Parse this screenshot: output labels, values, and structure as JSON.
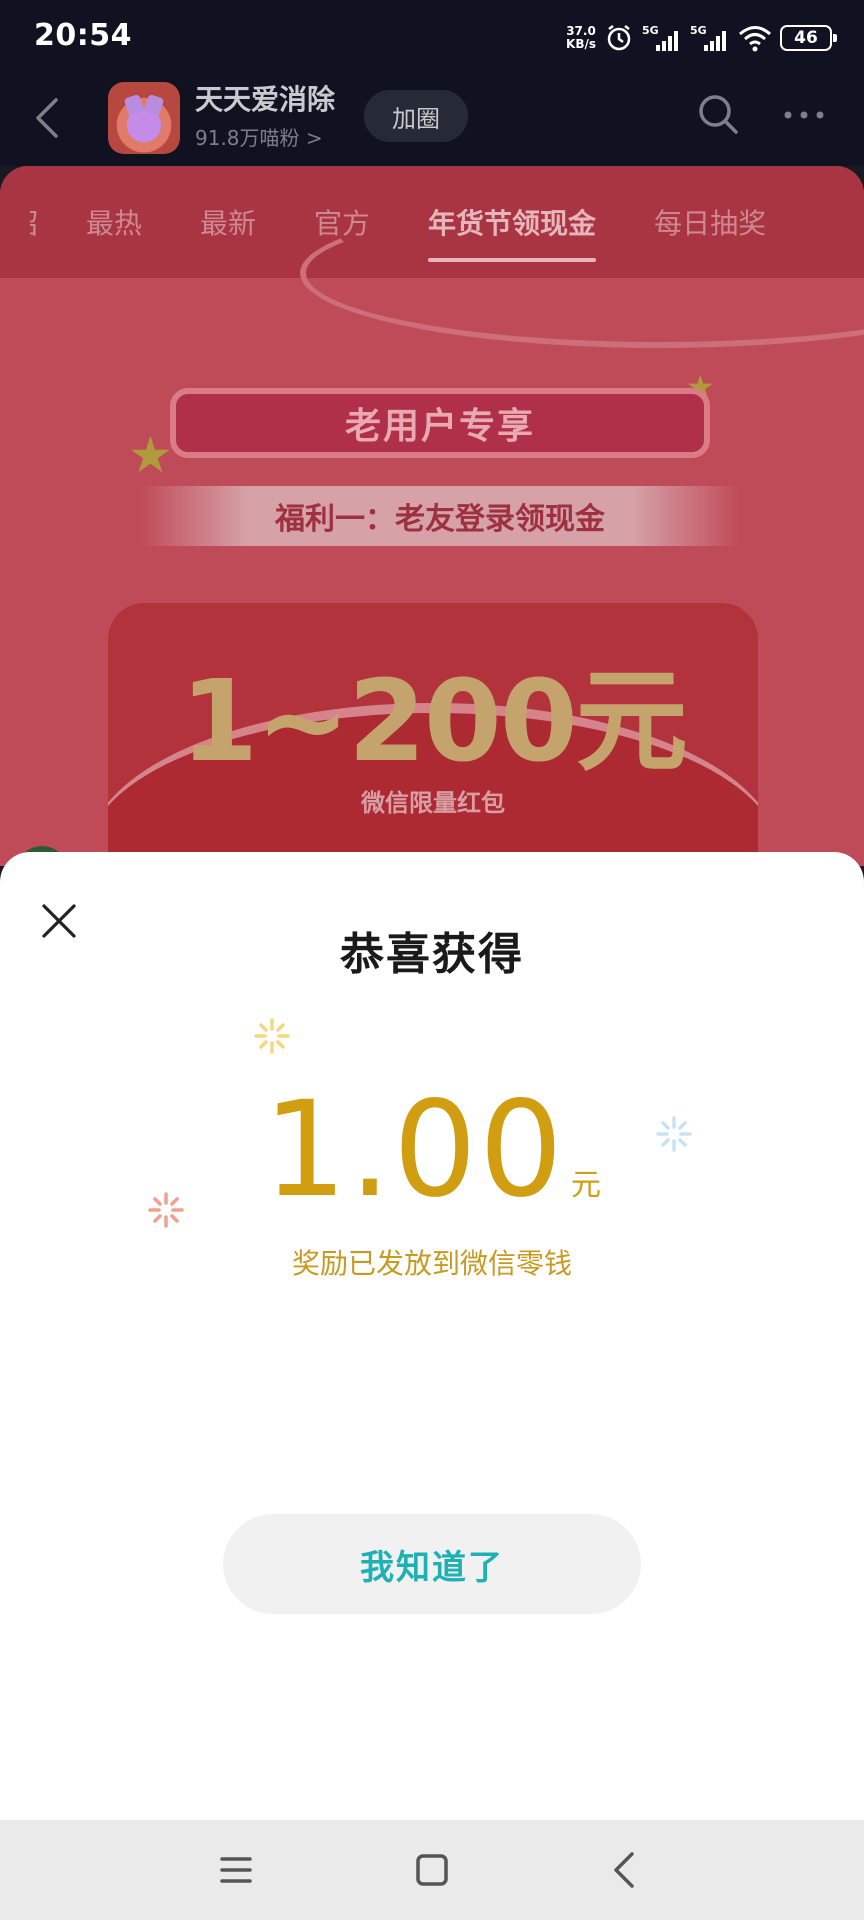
{
  "status_bar": {
    "time": "20:54",
    "net_speed_value": "37.0",
    "net_speed_unit": "KB/s",
    "signal1_label": "5G",
    "signal2_label": "5G",
    "battery": "46"
  },
  "header": {
    "app_name": "天天爱消除",
    "fans": "91.8万喵粉 >",
    "join_label": "加圈"
  },
  "tabs": [
    {
      "label": "最热"
    },
    {
      "label": "最新"
    },
    {
      "label": "官方"
    },
    {
      "label": "年货节领现金",
      "active": true
    },
    {
      "label": "每日抽奖"
    }
  ],
  "background_banner": {
    "title": "老用户专享",
    "benefit": "福利一：老友登录领现金",
    "amount": "1~200元",
    "subtitle": "微信限量红包"
  },
  "modal": {
    "title": "恭喜获得",
    "amount": "1.00",
    "unit": "元",
    "note": "奖励已发放到微信零钱",
    "confirm_label": "我知道了"
  },
  "colors": {
    "amount": "#d19e12",
    "confirm_text": "#1db1b6",
    "page_bg": "#b73e4c"
  }
}
